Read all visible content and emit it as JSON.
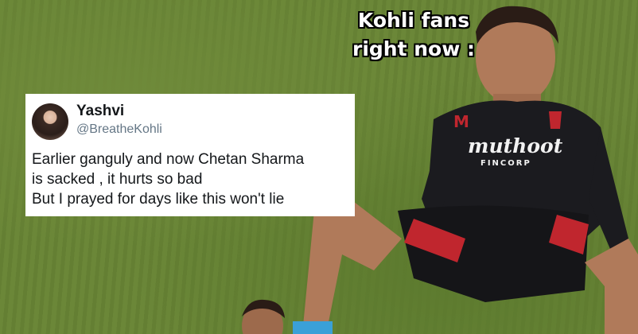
{
  "caption": "Kohli fans\nright now :",
  "tweet": {
    "name": "Yashvi",
    "handle": "@BreatheKohli",
    "text": "Earlier ganguly and now Chetan Sharma\n is sacked , it hurts so bad\nBut I prayed for days like this won't lie"
  },
  "jersey": {
    "sponsor": "muthoot",
    "sponsor_sub": "FINCORP"
  },
  "colors": {
    "grass": "#688335",
    "jersey": "#1b1b1f",
    "jersey_red": "#c0262e"
  }
}
